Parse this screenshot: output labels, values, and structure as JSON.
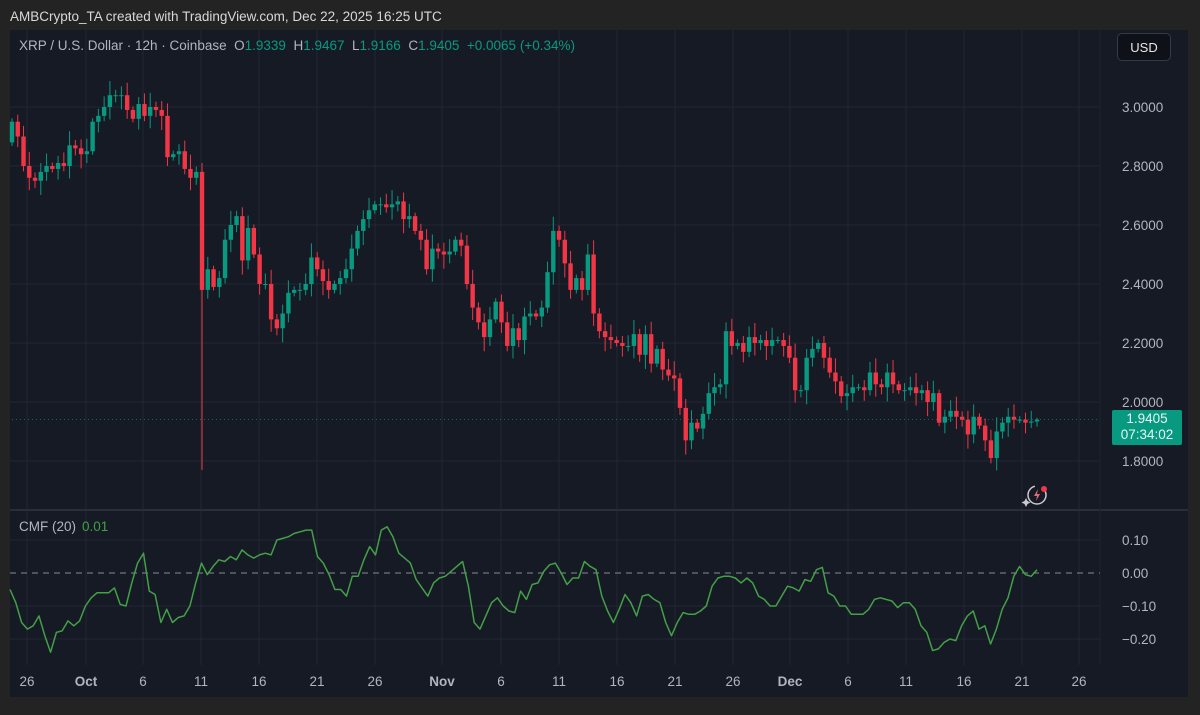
{
  "credit": "AMBCrypto_TA created with TradingView.com, Dec 22, 2025 16:25 UTC",
  "legend": {
    "symbol": "XRP / U.S. Dollar · 12h · Coinbase",
    "o_label": "O",
    "o": "1.9339",
    "h_label": "H",
    "h": "1.9467",
    "l_label": "L",
    "l": "1.9166",
    "c_label": "C",
    "c": "1.9405",
    "change": "+0.0065 (+0.34%)"
  },
  "currency_button": "USD",
  "price_tag": {
    "price": "1.9405",
    "countdown": "07:34:02"
  },
  "indicator": {
    "name": "CMF (20)",
    "value": "0.01"
  },
  "colors": {
    "up": "#089981",
    "down": "#f23645",
    "cmf_line": "#43a047",
    "background": "#161a25"
  },
  "icons": [
    "lightning-alert-icon"
  ],
  "chart_data": [
    {
      "type": "candlestick",
      "title": "XRP / U.S. Dollar · 12h · Coinbase",
      "ylim": [
        1.65,
        3.12
      ],
      "y_ticks": [
        "3.0000",
        "2.8000",
        "2.6000",
        "2.4000",
        "2.2000",
        "2.0000",
        "1.8000"
      ],
      "grid": true,
      "first_open": 2.88,
      "min_low": 1.77,
      "last_candle": {
        "open": 1.9339,
        "high": 1.9467,
        "low": 1.9166,
        "close": 1.9405
      },
      "close": [
        2.95,
        2.9,
        2.8,
        2.76,
        2.75,
        2.78,
        2.8,
        2.79,
        2.81,
        2.8,
        2.87,
        2.86,
        2.84,
        2.85,
        2.95,
        2.97,
        3.0,
        3.04,
        3.04,
        3.04,
        2.99,
        2.96,
        3.01,
        2.97,
        3.0,
        2.99,
        2.97,
        2.83,
        2.84,
        2.85,
        2.79,
        2.76,
        2.78,
        2.38,
        2.45,
        2.39,
        2.42,
        2.55,
        2.6,
        2.63,
        2.48,
        2.59,
        2.5,
        2.4,
        2.4,
        2.28,
        2.25,
        2.3,
        2.37,
        2.38,
        2.38,
        2.4,
        2.49,
        2.45,
        2.41,
        2.38,
        2.4,
        2.42,
        2.45,
        2.52,
        2.58,
        2.62,
        2.65,
        2.67,
        2.67,
        2.66,
        2.67,
        2.68,
        2.62,
        2.63,
        2.58,
        2.55,
        2.45,
        2.52,
        2.51,
        2.5,
        2.51,
        2.55,
        2.53,
        2.4,
        2.32,
        2.27,
        2.22,
        2.28,
        2.34,
        2.27,
        2.19,
        2.25,
        2.21,
        2.29,
        2.3,
        2.29,
        2.32,
        2.44,
        2.58,
        2.55,
        2.47,
        2.38,
        2.42,
        2.38,
        2.5,
        2.3,
        2.24,
        2.22,
        2.21,
        2.2,
        2.19,
        2.19,
        2.23,
        2.16,
        2.23,
        2.13,
        2.18,
        2.11,
        2.09,
        2.08,
        1.98,
        1.87,
        1.93,
        1.91,
        1.96,
        2.03,
        2.05,
        2.06,
        2.24,
        2.19,
        2.2,
        2.17,
        2.22,
        2.2,
        2.21,
        2.19,
        2.21,
        2.21,
        2.19,
        2.15,
        2.04,
        2.04,
        2.15,
        2.18,
        2.2,
        2.15,
        2.1,
        2.07,
        2.02,
        2.03,
        2.05,
        2.05,
        2.04,
        2.1,
        2.06,
        2.05,
        2.1,
        2.06,
        2.04,
        2.04,
        2.05,
        2.03,
        2.04,
        2.0,
        2.03,
        1.93,
        1.95,
        1.97,
        1.95,
        1.94,
        1.89,
        1.95,
        1.92,
        1.87,
        1.81,
        1.9,
        1.93,
        1.95,
        1.94,
        1.94,
        1.93,
        1.9339,
        1.9405
      ]
    },
    {
      "type": "line",
      "title": "CMF (20)",
      "ylim": [
        -0.28,
        0.2
      ],
      "y_ticks": [
        "0.10",
        "0.00",
        "−0.10",
        "−0.20"
      ],
      "reference_line": 0,
      "values": [
        -0.05,
        -0.09,
        -0.15,
        -0.17,
        -0.16,
        -0.13,
        -0.19,
        -0.24,
        -0.18,
        -0.175,
        -0.145,
        -0.16,
        -0.145,
        -0.1,
        -0.075,
        -0.06,
        -0.06,
        -0.06,
        -0.045,
        -0.095,
        -0.1,
        -0.03,
        0.03,
        0.06,
        -0.055,
        -0.065,
        -0.15,
        -0.11,
        -0.15,
        -0.135,
        -0.13,
        -0.1,
        -0.03,
        0.03,
        -0.005,
        0.02,
        0.04,
        0.035,
        0.05,
        0.04,
        0.07,
        0.055,
        0.045,
        0.055,
        0.06,
        0.055,
        0.1,
        0.105,
        0.11,
        0.12,
        0.125,
        0.13,
        0.13,
        0.05,
        0.03,
        -0.005,
        -0.05,
        -0.05,
        -0.07,
        -0.01,
        -0.01,
        0.04,
        0.08,
        0.055,
        0.13,
        0.14,
        0.11,
        0.06,
        0.045,
        0.03,
        -0.02,
        -0.045,
        -0.07,
        -0.03,
        -0.015,
        -0.01,
        0.005,
        0.02,
        0.035,
        -0.04,
        -0.15,
        -0.17,
        -0.13,
        -0.09,
        -0.075,
        -0.1,
        -0.115,
        -0.12,
        -0.055,
        -0.08,
        -0.035,
        -0.03,
        0.005,
        0.025,
        0.03,
        0.0,
        -0.035,
        -0.015,
        -0.015,
        0.035,
        0.02,
        0.01,
        -0.07,
        -0.115,
        -0.15,
        -0.11,
        -0.065,
        -0.09,
        -0.13,
        -0.07,
        -0.065,
        -0.08,
        -0.09,
        -0.15,
        -0.19,
        -0.15,
        -0.12,
        -0.125,
        -0.125,
        -0.115,
        -0.1,
        -0.04,
        -0.015,
        -0.01,
        -0.01,
        -0.015,
        -0.03,
        -0.015,
        -0.03,
        -0.07,
        -0.08,
        -0.1,
        -0.1,
        -0.07,
        -0.04,
        -0.045,
        -0.055,
        -0.02,
        -0.025,
        0.01,
        0.017,
        -0.06,
        -0.07,
        -0.1,
        -0.1,
        -0.125,
        -0.125,
        -0.125,
        -0.11,
        -0.08,
        -0.075,
        -0.08,
        -0.085,
        -0.105,
        -0.09,
        -0.09,
        -0.11,
        -0.16,
        -0.18,
        -0.235,
        -0.23,
        -0.21,
        -0.2,
        -0.205,
        -0.16,
        -0.13,
        -0.115,
        -0.17,
        -0.16,
        -0.215,
        -0.17,
        -0.11,
        -0.075,
        -0.01,
        0.02,
        -0.005,
        -0.01,
        0.01
      ]
    }
  ],
  "x_ticks": [
    "26",
    "Oct",
    "6",
    "11",
    "16",
    "21",
    "26",
    "Nov",
    "6",
    "11",
    "16",
    "21",
    "26",
    "Dec",
    "6",
    "11",
    "16",
    "21",
    "26"
  ]
}
